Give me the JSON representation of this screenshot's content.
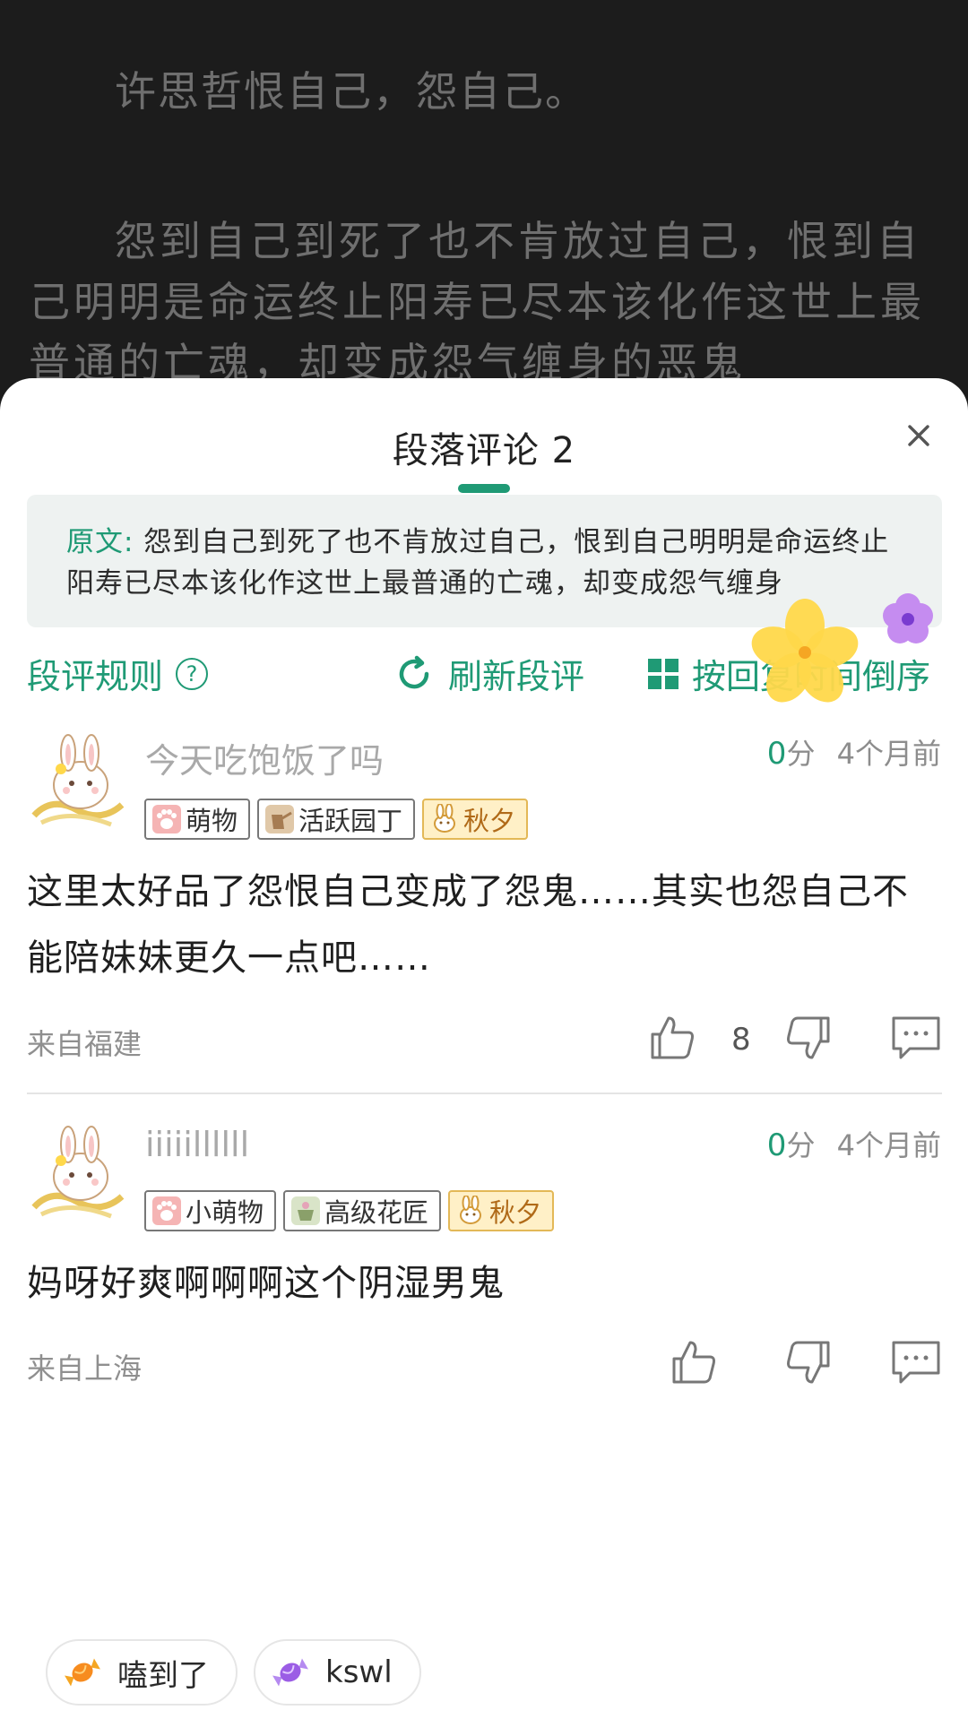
{
  "reader": {
    "para1": "许思哲恨自己，怨自己。",
    "para2": "怨到自己到死了也不肯放过自己，恨到自己明明是命运终止阳寿已尽本该化作这世上最普通的亡魂，却变成怨气缠身的恶鬼"
  },
  "sheet": {
    "title": "段落评论 2",
    "quote_label": "原文:",
    "quote_text": "怨到自己到死了也不肯放过自己，恨到自己明明是命运终止阳寿已尽本该化作这世上最普通的亡魂，却变成怨气缠身"
  },
  "toolbar": {
    "rules_label": "段评规则",
    "rules_help": "?",
    "refresh_label": "刷新段评",
    "sort_label": "按回复时间倒序"
  },
  "comments": [
    {
      "username": "今天吃饱饭了吗",
      "score": "0",
      "score_unit": "分",
      "time": "4个月前",
      "badges": [
        "萌物",
        "活跃园丁",
        "秋夕"
      ],
      "text": "这里太好品了怨恨自己变成了怨鬼……其实也怨自己不能陪妹妹更久一点吧……",
      "location": "来自福建",
      "likes": "8"
    },
    {
      "username": "iiiiillllll",
      "score": "0",
      "score_unit": "分",
      "time": "4个月前",
      "badges": [
        "小萌物",
        "高级花匠",
        "秋夕"
      ],
      "text": "妈呀好爽啊啊啊这个阴湿男鬼",
      "location": "来自上海",
      "likes": ""
    }
  ],
  "chips": [
    {
      "label": "嗑到了",
      "icon": "candy-orange-icon"
    },
    {
      "label": "kswl",
      "icon": "candy-purple-icon"
    }
  ],
  "colors": {
    "accent": "#1f9a75",
    "gold_badge_bg": "#fff0c7",
    "gold_badge_text": "#b06a18"
  }
}
